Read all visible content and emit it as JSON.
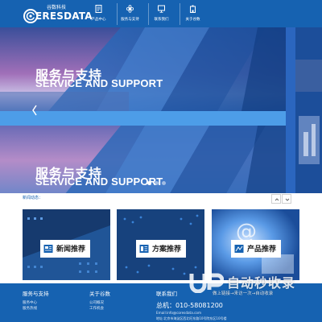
{
  "header": {
    "logo_cn": "谷数科技",
    "logo_text": "ERESDATA",
    "nav": [
      {
        "label": "产品中心",
        "icon": "document-icon"
      },
      {
        "label": "服务与支持",
        "icon": "flower-icon"
      },
      {
        "label": "联系我们",
        "icon": "monitor-icon"
      },
      {
        "label": "关于谷数",
        "icon": "building-icon"
      }
    ]
  },
  "banner": {
    "title_cn": "服务与支持",
    "title_en": "SERVICE AND SUPPORT",
    "slide_count": 3,
    "active_slide": 0
  },
  "news": {
    "label": "新闻动态："
  },
  "cards": [
    {
      "label": "新闻推荐",
      "icon": "news-icon"
    },
    {
      "label": "方案推荐",
      "icon": "solution-icon"
    },
    {
      "label": "产品推荐",
      "icon": "product-icon"
    }
  ],
  "footer": {
    "col1": {
      "title": "服务与支持",
      "links": [
        "服务中心",
        "服务热线"
      ]
    },
    "col2": {
      "title": "关于谷数",
      "links": [
        "公司概况",
        "工作机会"
      ]
    },
    "col3": {
      "title": "联系我们",
      "phone": "总机：010-58081200",
      "email": "Email:info@coresdata.com",
      "address": "地址:北京市海淀区西北旺东路10号院东区10号楼"
    }
  },
  "watermark": {
    "text": "自动秒收录",
    "sub": "做上链接→来访一次→自动收录"
  },
  "colors": {
    "brand_blue": "#1662b1",
    "banner_blue": "#2b5ca5"
  }
}
